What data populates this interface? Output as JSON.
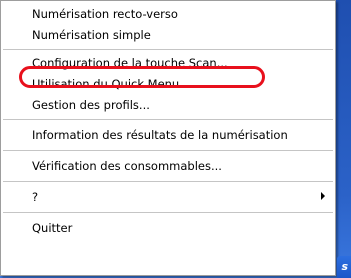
{
  "menu": {
    "items": [
      {
        "label": "Numérisation recto-verso"
      },
      {
        "label": "Numérisation simple"
      },
      {
        "label": "Configuration de la touche Scan..."
      },
      {
        "label": "Utilisation du Quick Menu"
      },
      {
        "label": "Gestion des profils..."
      },
      {
        "label": "Information des résultats de la numérisation"
      },
      {
        "label": "Vérification des consommables..."
      },
      {
        "label": "?"
      },
      {
        "label": "Quitter"
      }
    ],
    "highlight_color": "#e8101c"
  },
  "taskbar": {
    "corner_letter": "s"
  }
}
